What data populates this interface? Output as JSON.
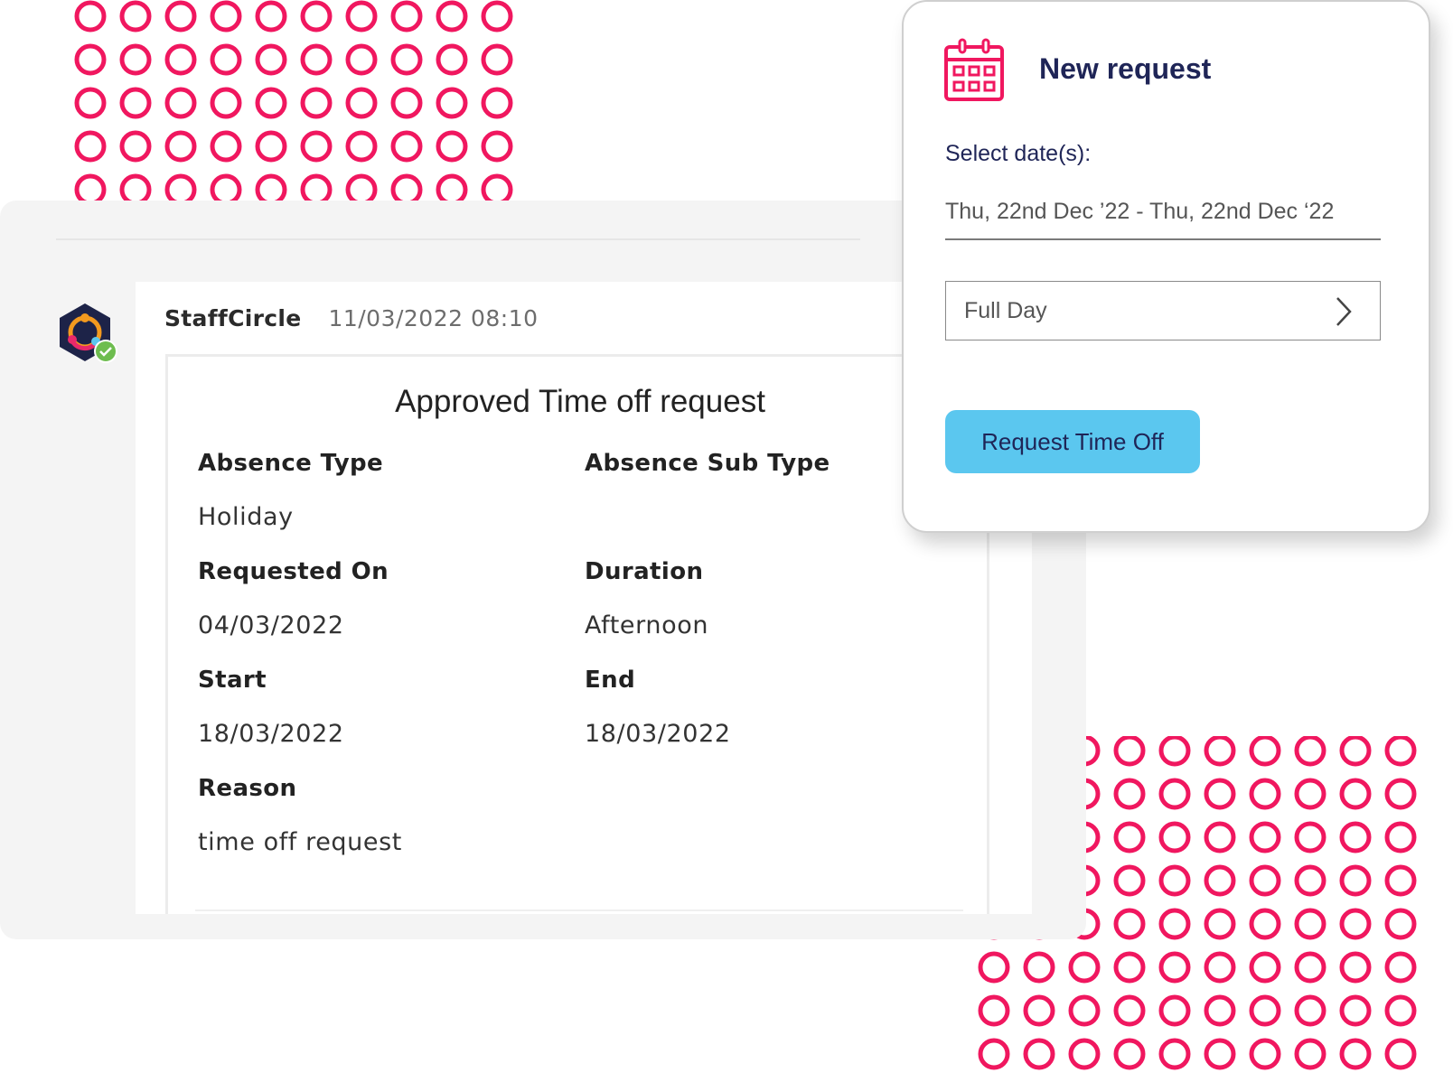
{
  "colors": {
    "accent_pink": "#f0175f",
    "button_blue": "#5bc7ef",
    "navy": "#1f2557",
    "panel_grey": "#f4f4f4"
  },
  "message": {
    "sender": "StaffCircle",
    "timestamp": "11/03/2022 08:10",
    "avatar_icon": "staffcircle-logo-icon",
    "status_icon": "online-check-icon"
  },
  "card": {
    "title": "Approved Time off request",
    "absence_type_label": "Absence Type",
    "absence_type_value": "Holiday",
    "absence_sub_type_label": "Absence Sub Type",
    "requested_on_label": "Requested On",
    "requested_on_value": "04/03/2022",
    "duration_label": "Duration",
    "duration_value": "Afternoon",
    "start_label": "Start",
    "start_value": "18/03/2022",
    "end_label": "End",
    "end_value": "18/03/2022",
    "reason_label": "Reason",
    "reason_value": "time off request"
  },
  "request": {
    "icon": "calendar-icon",
    "title": "New request",
    "date_label": "Select date(s):",
    "date_value": "Thu, 22nd Dec ’22 - Thu, 22nd Dec ‘22",
    "duration_value": "Full Day",
    "duration_icon": "chevron-right-icon",
    "button_label": "Request Time Off"
  }
}
